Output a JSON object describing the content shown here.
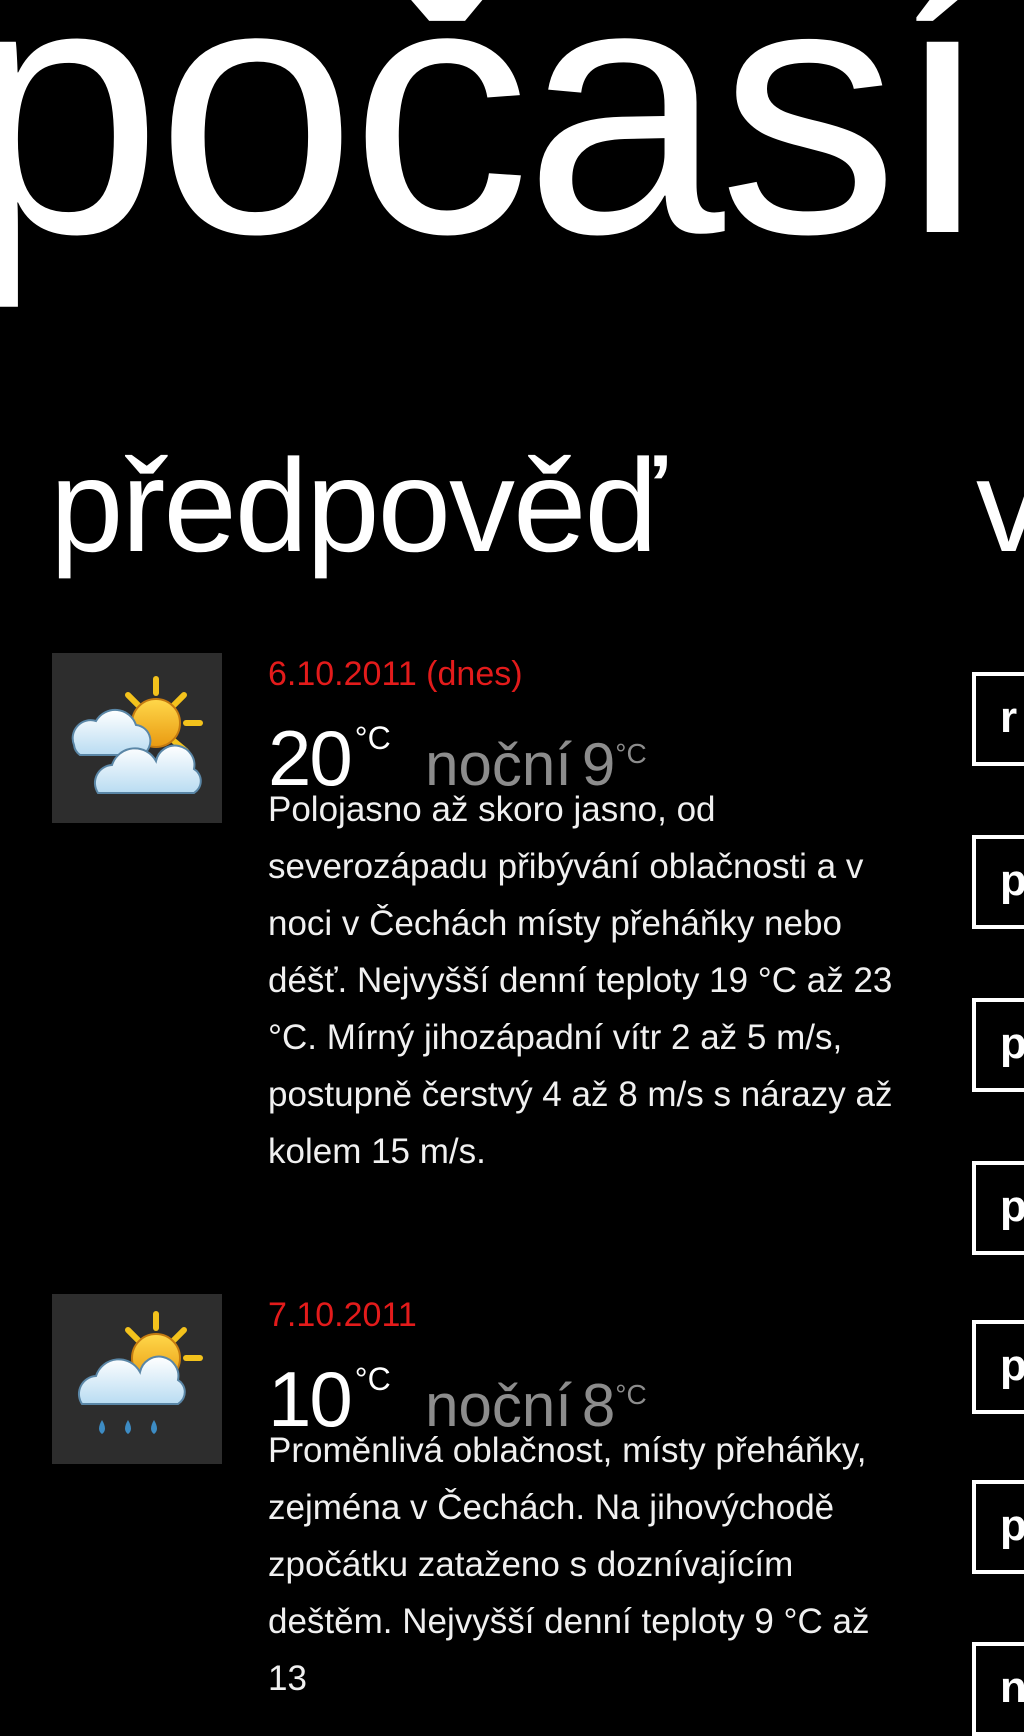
{
  "app": {
    "title": "počasí"
  },
  "sections": {
    "forecast_title": "předpověď",
    "next_title": "v"
  },
  "forecast": [
    {
      "date": "6.10.2011 (dnes)",
      "high": "20",
      "high_unit": "°C",
      "night_label": "noční",
      "night": "9",
      "night_unit": "°C",
      "icon": "partly-cloudy-sun-icon",
      "description": "Polojasno až skoro jasno, od severozápadu přibývání oblačnosti a v noci v Čechách místy přeháňky nebo déšť. Nejvyšší denní teploty 19 °C až 23 °C. Mírný jihozápadní vítr 2 až 5 m/s, postupně čerstvý 4 až 8 m/s s nárazy až kolem 15 m/s."
    },
    {
      "date": "7.10.2011",
      "high": "10",
      "high_unit": "°C",
      "night_label": "noční",
      "night": "8",
      "night_unit": "°C",
      "icon": "rain-cloud-sun-icon",
      "description": "Proměnlivá oblačnost, místy přeháňky, zejména v Čechách. Na jihovýchodě zpočátku zataženo s doznívajícím deštěm. Nejvyšší denní teploty 9 °C až 13"
    }
  ],
  "side_tiles": [
    "r",
    "p",
    "p",
    "p",
    "p",
    "p",
    "n"
  ],
  "colors": {
    "background": "#000000",
    "accent_date": "#e31b1b",
    "night_temp": "#8c8c8c",
    "icon_tile": "#2d2d2d"
  }
}
